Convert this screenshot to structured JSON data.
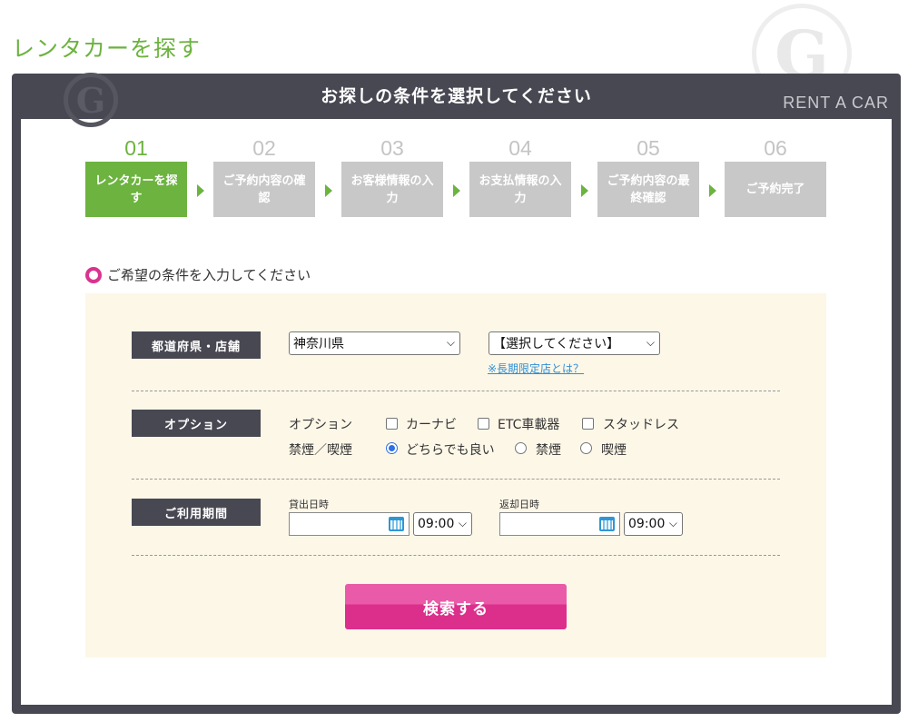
{
  "page_title": "レンタカーを探す",
  "watermark_letter": "G",
  "frame": {
    "title": "お探しの条件を選択してください",
    "subtitle": "RENT A CAR"
  },
  "steps": [
    {
      "num": "01",
      "label": "レンタカーを探す",
      "active": true
    },
    {
      "num": "02",
      "label": "ご予約内容の確認",
      "active": false
    },
    {
      "num": "03",
      "label": "お客様情報の入力",
      "active": false
    },
    {
      "num": "04",
      "label": "お支払情報の入力",
      "active": false
    },
    {
      "num": "05",
      "label": "ご予約内容の最終確認",
      "active": false
    },
    {
      "num": "06",
      "label": "ご予約完了",
      "active": false
    }
  ],
  "section_heading": "ご希望の条件を入力してください",
  "prefecture_row": {
    "label": "都道府県・店舗",
    "prefecture_value": "神奈川県",
    "store_value": "【選択してください】",
    "long_term_link": "※長期限定店とは？"
  },
  "option_row": {
    "label": "オプション",
    "options_label": "オプション",
    "checkboxes": [
      "カーナビ",
      "ETC車載器",
      "スタッドレス"
    ],
    "smoking_label": "禁煙／喫煙",
    "radios": [
      "どちらでも良い",
      "禁煙",
      "喫煙"
    ],
    "selected_radio": "どちらでも良い"
  },
  "period_row": {
    "label": "ご利用期間",
    "pickup_label": "貸出日時",
    "pickup_date": "",
    "pickup_time": "09:00",
    "return_label": "返却日時",
    "return_date": "",
    "return_time": "09:00"
  },
  "search_button": "検索する",
  "colors": {
    "accent_green": "#6cb33f",
    "frame_dark": "#474852",
    "panel_bg": "#fdf7e8",
    "button_pink": "#dc2f8c",
    "link_blue": "#2f8fd6"
  }
}
